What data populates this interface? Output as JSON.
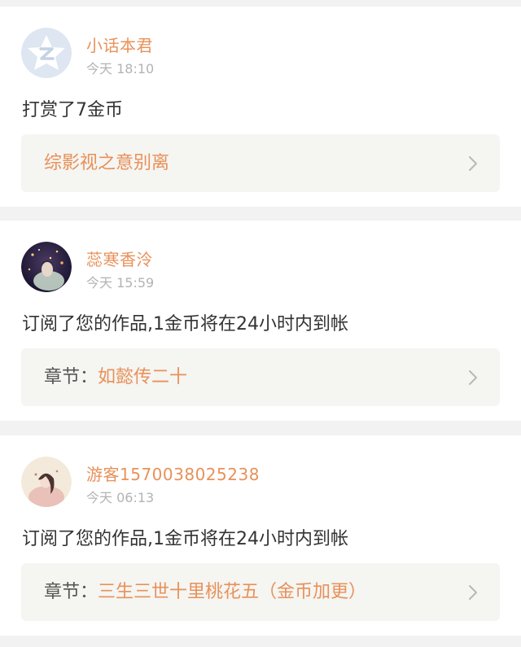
{
  "colors": {
    "accent": "#e8915a",
    "text_primary": "#333333",
    "text_secondary": "#b3b3b3",
    "card_background": "#ffffff",
    "page_background": "#f2f2f2",
    "reference_background": "#f5f5f2"
  },
  "notifications": [
    {
      "username": "小话本君",
      "time": "今天 18:10",
      "message": "打赏了7金币",
      "avatar_icon": "default-avatar-icon",
      "reference": {
        "prefix": "",
        "value": "综影视之意别离"
      }
    },
    {
      "username": "蕊寒香泠",
      "time": "今天 15:59",
      "message": "订阅了您的作品,1金币将在24小时内到帐",
      "avatar_icon": "user-avatar-icon",
      "reference": {
        "prefix": "章节：",
        "value": "如懿传二十"
      }
    },
    {
      "username": "游客1570038025238",
      "time": "今天 06:13",
      "message": "订阅了您的作品,1金币将在24小时内到帐",
      "avatar_icon": "user-avatar-icon",
      "reference": {
        "prefix": "章节：",
        "value": "三生三世十里桃花五（金币加更）"
      }
    }
  ]
}
